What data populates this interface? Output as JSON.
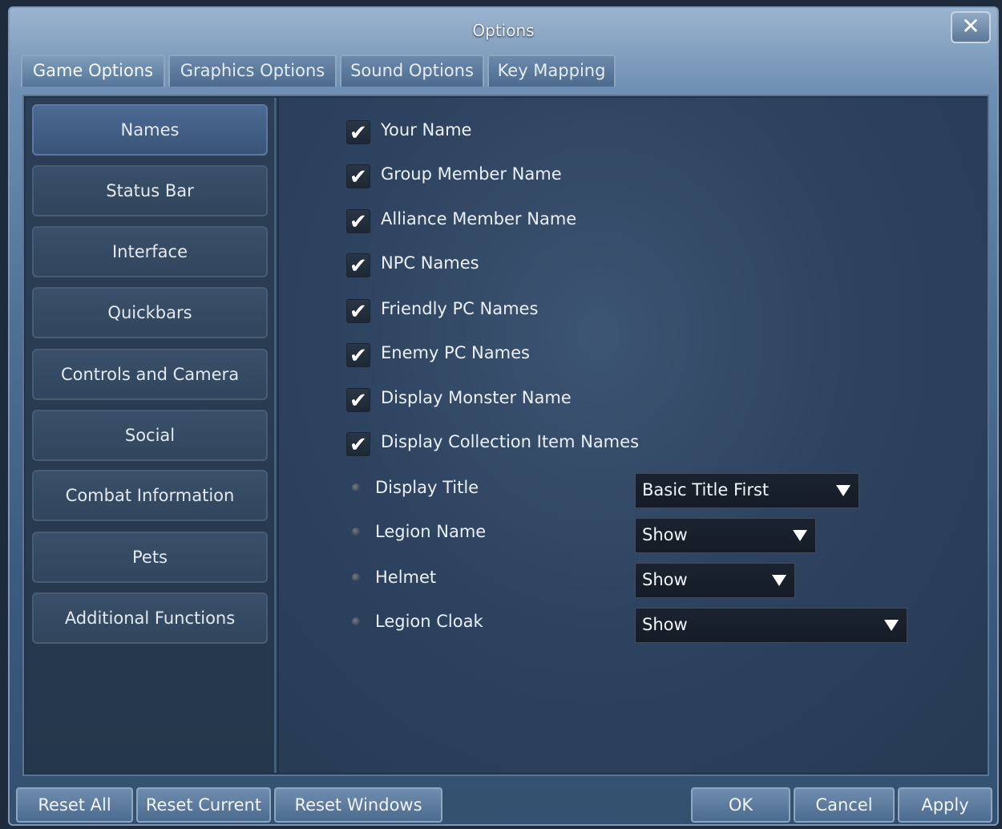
{
  "window": {
    "title": "Options"
  },
  "tabs": [
    {
      "label": "Game Options",
      "active": true
    },
    {
      "label": "Graphics Options",
      "active": false
    },
    {
      "label": "Sound Options",
      "active": false
    },
    {
      "label": "Key Mapping",
      "active": false
    }
  ],
  "sidebar": {
    "items": [
      {
        "label": "Names",
        "active": true
      },
      {
        "label": "Status Bar"
      },
      {
        "label": "Interface"
      },
      {
        "label": "Quickbars"
      },
      {
        "label": "Controls and Camera"
      },
      {
        "label": "Social"
      },
      {
        "label": "Combat Information"
      },
      {
        "label": "Pets"
      },
      {
        "label": "Additional Functions"
      }
    ]
  },
  "names_options": {
    "checkboxes": [
      {
        "label": "Your Name",
        "checked": true
      },
      {
        "label": "Group Member Name",
        "checked": true
      },
      {
        "label": "Alliance Member Name",
        "checked": true
      },
      {
        "label": "NPC Names",
        "checked": true
      },
      {
        "label": "Friendly PC Names",
        "checked": true
      },
      {
        "label": "Enemy PC Names",
        "checked": true
      },
      {
        "label": "Display Monster Name",
        "checked": true
      },
      {
        "label": "Display Collection Item Names",
        "checked": true
      }
    ],
    "dropdowns": [
      {
        "label": "Display Title",
        "value": "Basic Title First"
      },
      {
        "label": "Legion Name",
        "value": "Show"
      },
      {
        "label": "Helmet",
        "value": "Show"
      },
      {
        "label": "Legion Cloak",
        "value": "Show"
      }
    ]
  },
  "buttons": {
    "reset_all": "Reset All",
    "reset_current": "Reset Current",
    "reset_windows": "Reset Windows",
    "ok": "OK",
    "cancel": "Cancel",
    "apply": "Apply"
  },
  "icons": {
    "close": "close-icon",
    "check": "checkmark-icon",
    "dropdown_arrow": "triangle-down-icon"
  },
  "glyphs": {
    "close": "✕",
    "check": "✔"
  }
}
